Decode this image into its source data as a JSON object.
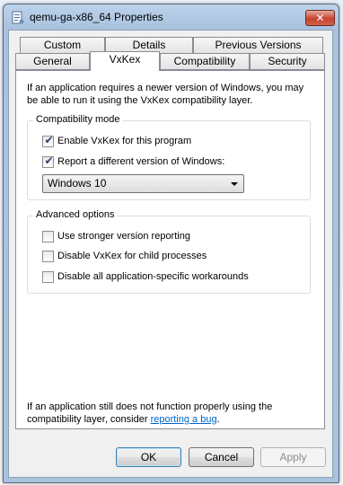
{
  "window": {
    "title": "qemu-ga-x86_64 Properties",
    "close_glyph": "✕"
  },
  "tabs": {
    "row1": [
      {
        "label": "Custom"
      },
      {
        "label": "Details"
      },
      {
        "label": "Previous Versions"
      }
    ],
    "row2": [
      {
        "label": "General"
      },
      {
        "label": "VxKex",
        "selected": true
      },
      {
        "label": "Compatibility"
      },
      {
        "label": "Security"
      }
    ]
  },
  "content": {
    "intro": "If an application requires a newer version of Windows, you may be able to run it using the VxKex compatibility layer.",
    "compat_group": {
      "label": "Compatibility mode",
      "enable_vxkex": {
        "label": "Enable VxKex for this program",
        "checked": true
      },
      "report_version": {
        "label": "Report a different version of Windows:",
        "checked": true
      },
      "version_select": {
        "value": "Windows 10"
      }
    },
    "advanced_group": {
      "label": "Advanced options",
      "stronger_reporting": {
        "label": "Use stronger version reporting",
        "checked": false
      },
      "disable_child": {
        "label": "Disable VxKex for child processes",
        "checked": false
      },
      "disable_workarounds": {
        "label": "Disable all application-specific workarounds",
        "checked": false
      }
    },
    "footer_text": "If an application still does not function properly using the compatibility layer, consider ",
    "footer_link": "reporting a bug",
    "footer_end": "."
  },
  "buttons": {
    "ok": "OK",
    "cancel": "Cancel",
    "apply": "Apply"
  },
  "icons": {
    "app": "app-file-icon",
    "check": "✔"
  },
  "colors": {
    "accent_link": "#0066cc",
    "close_button": "#c7432f"
  }
}
